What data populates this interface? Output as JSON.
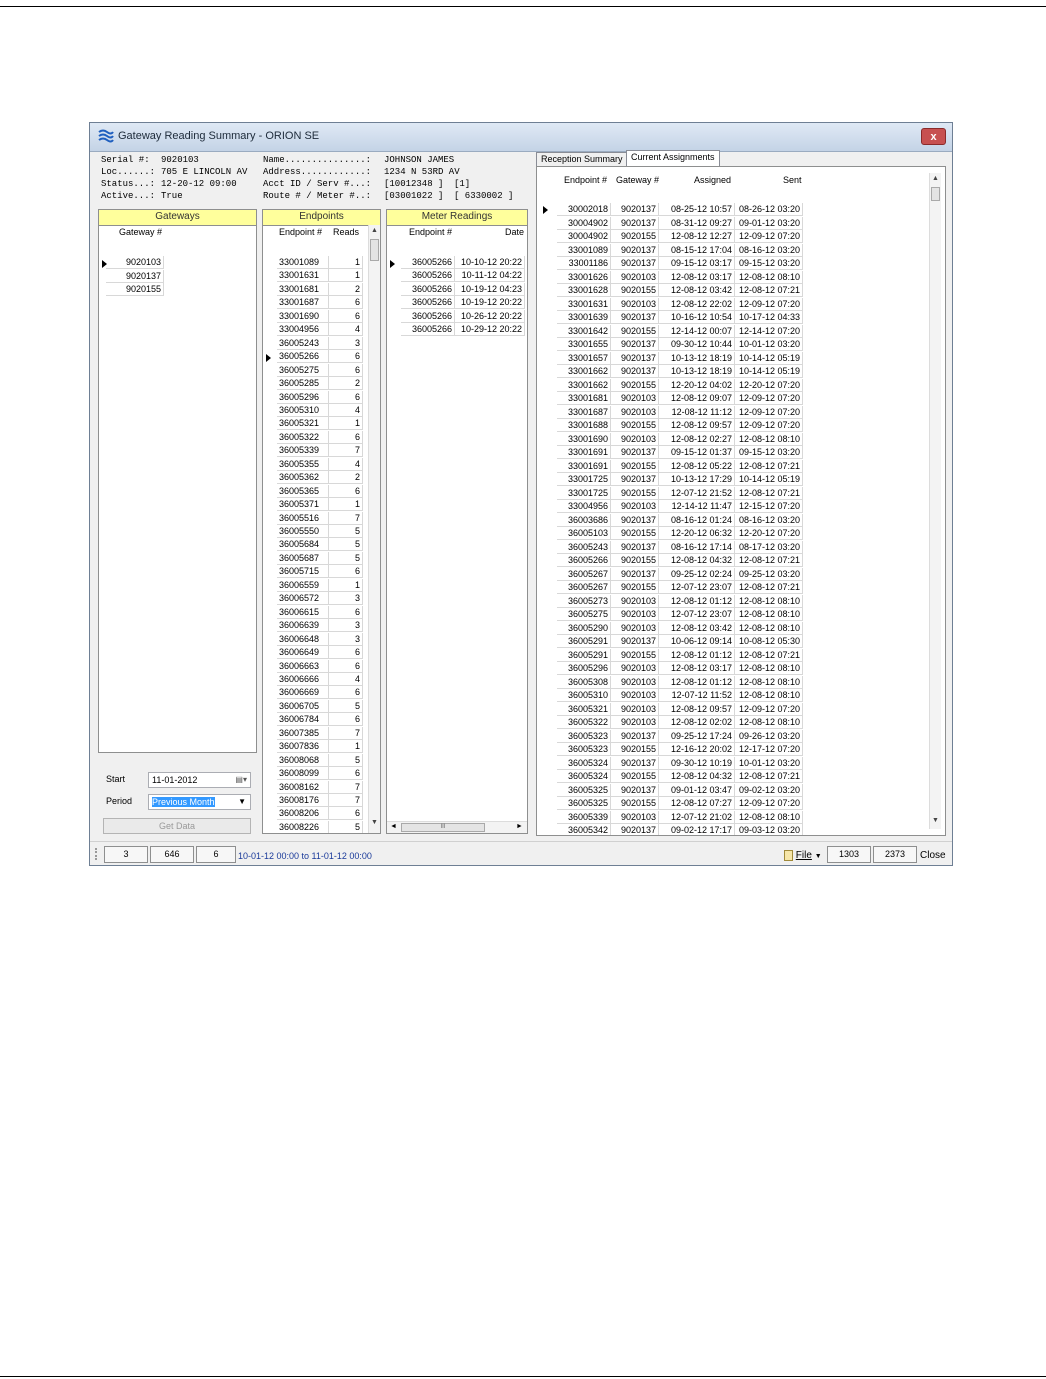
{
  "window": {
    "title": "Gateway Reading Summary - ORION SE",
    "close_label": "x"
  },
  "gateway_info": [
    {
      "label": "Serial #:",
      "value": "9020103"
    },
    {
      "label": "Loc......:",
      "value": "705 E LINCOLN AV"
    },
    {
      "label": "Status...:",
      "value": "12-20-12 09:00"
    },
    {
      "label": "Active...:",
      "value": "True"
    }
  ],
  "customer_info": [
    {
      "label": "Name...............:",
      "value": "JOHNSON JAMES",
      "value2": ""
    },
    {
      "label": "Address............:",
      "value": "1234 N 53RD AV",
      "value2": ""
    },
    {
      "label": "Acct ID / Serv #...:",
      "value": "[10012348 ]",
      "value2": "[1]"
    },
    {
      "label": "Route # / Meter #..:",
      "value": "[03001022 ]",
      "value2": "[ 6330002 ]"
    }
  ],
  "gateways": {
    "title": "Gateways",
    "col": "Gateway #",
    "rows": [
      "9020103",
      "9020137",
      "9020155"
    ]
  },
  "endpoints": {
    "title": "Endpoints",
    "cols": [
      "Endpoint #",
      "Reads"
    ],
    "rows": [
      [
        "33001089",
        "1"
      ],
      [
        "33001631",
        "1"
      ],
      [
        "33001681",
        "2"
      ],
      [
        "33001687",
        "6"
      ],
      [
        "33001690",
        "6"
      ],
      [
        "33004956",
        "4"
      ],
      [
        "36005243",
        "3"
      ],
      [
        "36005266",
        "6"
      ],
      [
        "36005275",
        "6"
      ],
      [
        "36005285",
        "2"
      ],
      [
        "36005296",
        "6"
      ],
      [
        "36005310",
        "4"
      ],
      [
        "36005321",
        "1"
      ],
      [
        "36005322",
        "6"
      ],
      [
        "36005339",
        "7"
      ],
      [
        "36005355",
        "4"
      ],
      [
        "36005362",
        "2"
      ],
      [
        "36005365",
        "6"
      ],
      [
        "36005371",
        "1"
      ],
      [
        "36005516",
        "7"
      ],
      [
        "36005550",
        "5"
      ],
      [
        "36005684",
        "5"
      ],
      [
        "36005687",
        "5"
      ],
      [
        "36005715",
        "6"
      ],
      [
        "36006559",
        "1"
      ],
      [
        "36006572",
        "3"
      ],
      [
        "36006615",
        "6"
      ],
      [
        "36006639",
        "3"
      ],
      [
        "36006648",
        "3"
      ],
      [
        "36006649",
        "6"
      ],
      [
        "36006663",
        "6"
      ],
      [
        "36006666",
        "4"
      ],
      [
        "36006669",
        "6"
      ],
      [
        "36006705",
        "5"
      ],
      [
        "36006784",
        "6"
      ],
      [
        "36007385",
        "7"
      ],
      [
        "36007836",
        "1"
      ],
      [
        "36008068",
        "5"
      ],
      [
        "36008099",
        "6"
      ],
      [
        "36008162",
        "7"
      ],
      [
        "36008176",
        "7"
      ],
      [
        "36008206",
        "6"
      ],
      [
        "36008226",
        "5"
      ]
    ]
  },
  "readings": {
    "title": "Meter Readings",
    "cols": [
      "Endpoint #",
      "Date"
    ],
    "rows": [
      [
        "36005266",
        "10-10-12 20:22"
      ],
      [
        "36005266",
        "10-11-12 04:22"
      ],
      [
        "36005266",
        "10-19-12 04:23"
      ],
      [
        "36005266",
        "10-19-12 20:22"
      ],
      [
        "36005266",
        "10-26-12 20:22"
      ],
      [
        "36005266",
        "10-29-12 20:22"
      ]
    ],
    "hscroll_grip": "III"
  },
  "controls": {
    "start_label": "Start",
    "start_value": "11-01-2012",
    "period_label": "Period",
    "period_value": "Previous Month",
    "get_data": "Get Data"
  },
  "tabs": [
    "Reception Summary",
    "Current Assignments"
  ],
  "assignments": {
    "cols": [
      "Endpoint #",
      "Gateway #",
      "Assigned",
      "Sent"
    ],
    "rows": [
      [
        "30002018",
        "9020137",
        "08-25-12 10:57",
        "08-26-12 03:20"
      ],
      [
        "30004902",
        "9020137",
        "08-31-12 09:27",
        "09-01-12 03:20"
      ],
      [
        "30004902",
        "9020155",
        "12-08-12 12:27",
        "12-09-12 07:20"
      ],
      [
        "33001089",
        "9020137",
        "08-15-12 17:04",
        "08-16-12 03:20"
      ],
      [
        "33001186",
        "9020137",
        "09-15-12 03:17",
        "09-15-12 03:20"
      ],
      [
        "33001626",
        "9020103",
        "12-08-12 03:17",
        "12-08-12 08:10"
      ],
      [
        "33001628",
        "9020155",
        "12-08-12 03:42",
        "12-08-12 07:21"
      ],
      [
        "33001631",
        "9020103",
        "12-08-12 22:02",
        "12-09-12 07:20"
      ],
      [
        "33001639",
        "9020137",
        "10-16-12 10:54",
        "10-17-12 04:33"
      ],
      [
        "33001642",
        "9020155",
        "12-14-12 00:07",
        "12-14-12 07:20"
      ],
      [
        "33001655",
        "9020137",
        "09-30-12 10:44",
        "10-01-12 03:20"
      ],
      [
        "33001657",
        "9020137",
        "10-13-12 18:19",
        "10-14-12 05:19"
      ],
      [
        "33001662",
        "9020137",
        "10-13-12 18:19",
        "10-14-12 05:19"
      ],
      [
        "33001662",
        "9020155",
        "12-20-12 04:02",
        "12-20-12 07:20"
      ],
      [
        "33001681",
        "9020103",
        "12-08-12 09:07",
        "12-09-12 07:20"
      ],
      [
        "33001687",
        "9020103",
        "12-08-12 11:12",
        "12-09-12 07:20"
      ],
      [
        "33001688",
        "9020155",
        "12-08-12 09:57",
        "12-09-12 07:20"
      ],
      [
        "33001690",
        "9020103",
        "12-08-12 02:27",
        "12-08-12 08:10"
      ],
      [
        "33001691",
        "9020137",
        "09-15-12 01:37",
        "09-15-12 03:20"
      ],
      [
        "33001691",
        "9020155",
        "12-08-12 05:22",
        "12-08-12 07:21"
      ],
      [
        "33001725",
        "9020137",
        "10-13-12 17:29",
        "10-14-12 05:19"
      ],
      [
        "33001725",
        "9020155",
        "12-07-12 21:52",
        "12-08-12 07:21"
      ],
      [
        "33004956",
        "9020103",
        "12-14-12 11:47",
        "12-15-12 07:20"
      ],
      [
        "36003686",
        "9020137",
        "08-16-12 01:24",
        "08-16-12 03:20"
      ],
      [
        "36005103",
        "9020155",
        "12-20-12 06:32",
        "12-20-12 07:20"
      ],
      [
        "36005243",
        "9020137",
        "08-16-12 17:14",
        "08-17-12 03:20"
      ],
      [
        "36005266",
        "9020155",
        "12-08-12 04:32",
        "12-08-12 07:21"
      ],
      [
        "36005267",
        "9020137",
        "09-25-12 02:24",
        "09-25-12 03:20"
      ],
      [
        "36005267",
        "9020155",
        "12-07-12 23:07",
        "12-08-12 07:21"
      ],
      [
        "36005273",
        "9020103",
        "12-08-12 01:12",
        "12-08-12 08:10"
      ],
      [
        "36005275",
        "9020103",
        "12-07-12 23:07",
        "12-08-12 08:10"
      ],
      [
        "36005290",
        "9020103",
        "12-08-12 03:42",
        "12-08-12 08:10"
      ],
      [
        "36005291",
        "9020137",
        "10-06-12 09:14",
        "10-08-12 05:30"
      ],
      [
        "36005291",
        "9020155",
        "12-08-12 01:12",
        "12-08-12 07:21"
      ],
      [
        "36005296",
        "9020103",
        "12-08-12 03:17",
        "12-08-12 08:10"
      ],
      [
        "36005308",
        "9020103",
        "12-08-12 01:12",
        "12-08-12 08:10"
      ],
      [
        "36005310",
        "9020103",
        "12-07-12 11:52",
        "12-08-12 08:10"
      ],
      [
        "36005321",
        "9020103",
        "12-08-12 09:57",
        "12-09-12 07:20"
      ],
      [
        "36005322",
        "9020103",
        "12-08-12 02:02",
        "12-08-12 08:10"
      ],
      [
        "36005323",
        "9020137",
        "09-25-12 17:24",
        "09-26-12 03:20"
      ],
      [
        "36005323",
        "9020155",
        "12-16-12 20:02",
        "12-17-12 07:20"
      ],
      [
        "36005324",
        "9020137",
        "09-30-12 10:19",
        "10-01-12 03:20"
      ],
      [
        "36005324",
        "9020155",
        "12-08-12 04:32",
        "12-08-12 07:21"
      ],
      [
        "36005325",
        "9020137",
        "09-01-12 03:47",
        "09-02-12 03:20"
      ],
      [
        "36005325",
        "9020155",
        "12-08-12 07:27",
        "12-09-12 07:20"
      ],
      [
        "36005339",
        "9020103",
        "12-07-12 21:02",
        "12-08-12 08:10"
      ],
      [
        "36005342",
        "9020137",
        "09-02-12 17:17",
        "09-03-12 03:20"
      ]
    ]
  },
  "statusbar": {
    "count1": "3",
    "count2": "646",
    "count3": "6",
    "range": "10-01-12 00:00 to 11-01-12 00:00",
    "file_label": "File",
    "count4": "1303",
    "count5": "2373",
    "close_label": "Close"
  }
}
